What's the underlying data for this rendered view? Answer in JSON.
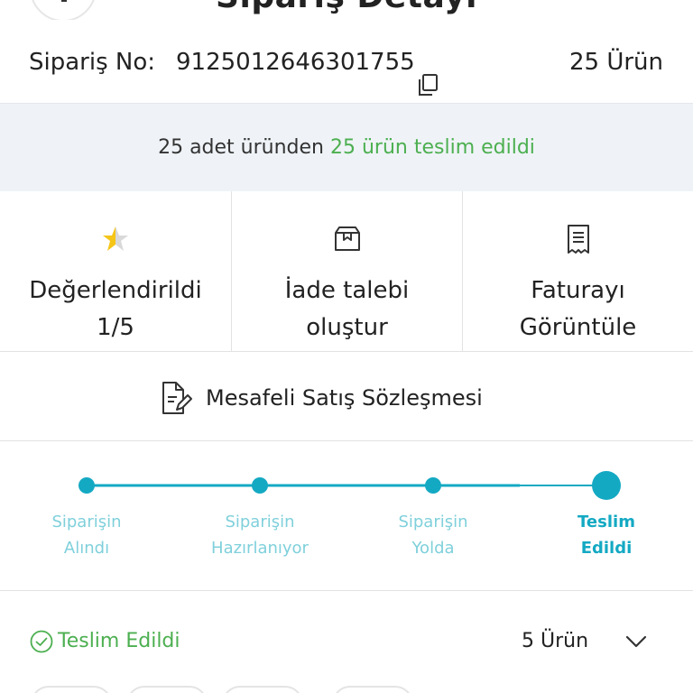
{
  "header": {
    "title": "Sipariş Detayı",
    "back_icon": "chevron-left-icon"
  },
  "order": {
    "number_label": "Sipariş No:",
    "number_value": "9125012646301755",
    "copy_icon": "copy-icon",
    "item_count": "25 Ürün"
  },
  "delivery_summary": {
    "prefix": "25 adet üründen",
    "highlight": "25 ürün teslim edildi",
    "highlight_color": "#4caf50"
  },
  "actions": [
    {
      "icon": "star-icon",
      "line1": "Değerlendirildi",
      "line2": "1/5"
    },
    {
      "icon": "return-box-icon",
      "line1": "İade talebi",
      "line2": "oluştur"
    },
    {
      "icon": "invoice-icon",
      "line1": "Faturayı",
      "line2": "Görüntüle"
    }
  ],
  "contract": {
    "icon": "document-edit-icon",
    "label": "Mesafeli Satış Sözleşmesi"
  },
  "progress": {
    "accent_color": "#14a9c3",
    "steps": [
      {
        "line1": "Siparişin",
        "line2": "Alındı",
        "active": false
      },
      {
        "line1": "Siparişin",
        "line2": "Hazırlanıyor",
        "active": false
      },
      {
        "line1": "Siparişin",
        "line2": "Yolda",
        "active": false
      },
      {
        "line1": "Teslim",
        "line2": "Edildi",
        "active": true
      }
    ]
  },
  "shipment": {
    "status_icon": "check-circle-icon",
    "status_label": "Teslim Edildi",
    "status_color": "#4caf50",
    "item_count": "5 Ürün",
    "expand_icon": "chevron-down-icon"
  }
}
